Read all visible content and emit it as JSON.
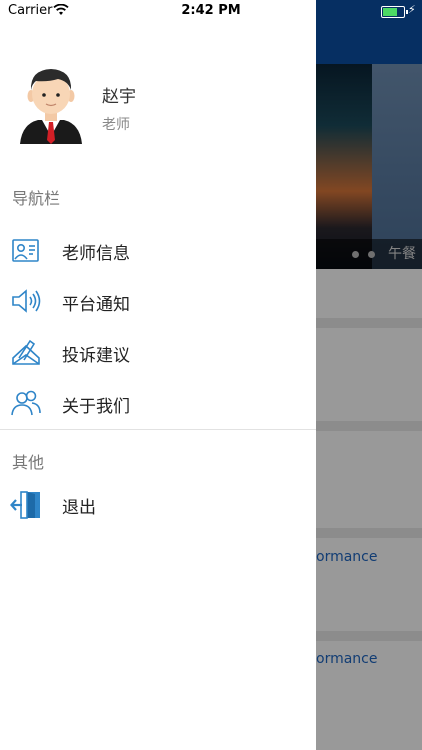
{
  "status_bar": {
    "carrier": "Carrier",
    "time": "2:42 PM"
  },
  "user": {
    "name": "赵宇",
    "role": "老师"
  },
  "nav_section_title": "导航栏",
  "nav_items": [
    {
      "label": "老师信息",
      "icon": "teacher-info-icon"
    },
    {
      "label": "平台通知",
      "icon": "speaker-icon"
    },
    {
      "label": "投诉建议",
      "icon": "complaint-pen-icon"
    },
    {
      "label": "关于我们",
      "icon": "users-icon"
    }
  ],
  "other_section_title": "其他",
  "other_items": [
    {
      "label": "退出",
      "icon": "exit-door-icon"
    }
  ],
  "background_app": {
    "banner_caption": "午餐",
    "links": [
      "ormance",
      "ormance"
    ]
  },
  "colors": {
    "accent_icon": "#2f85c8",
    "header_blue": "#0a4fa3",
    "link_blue": "#1f66c1"
  }
}
